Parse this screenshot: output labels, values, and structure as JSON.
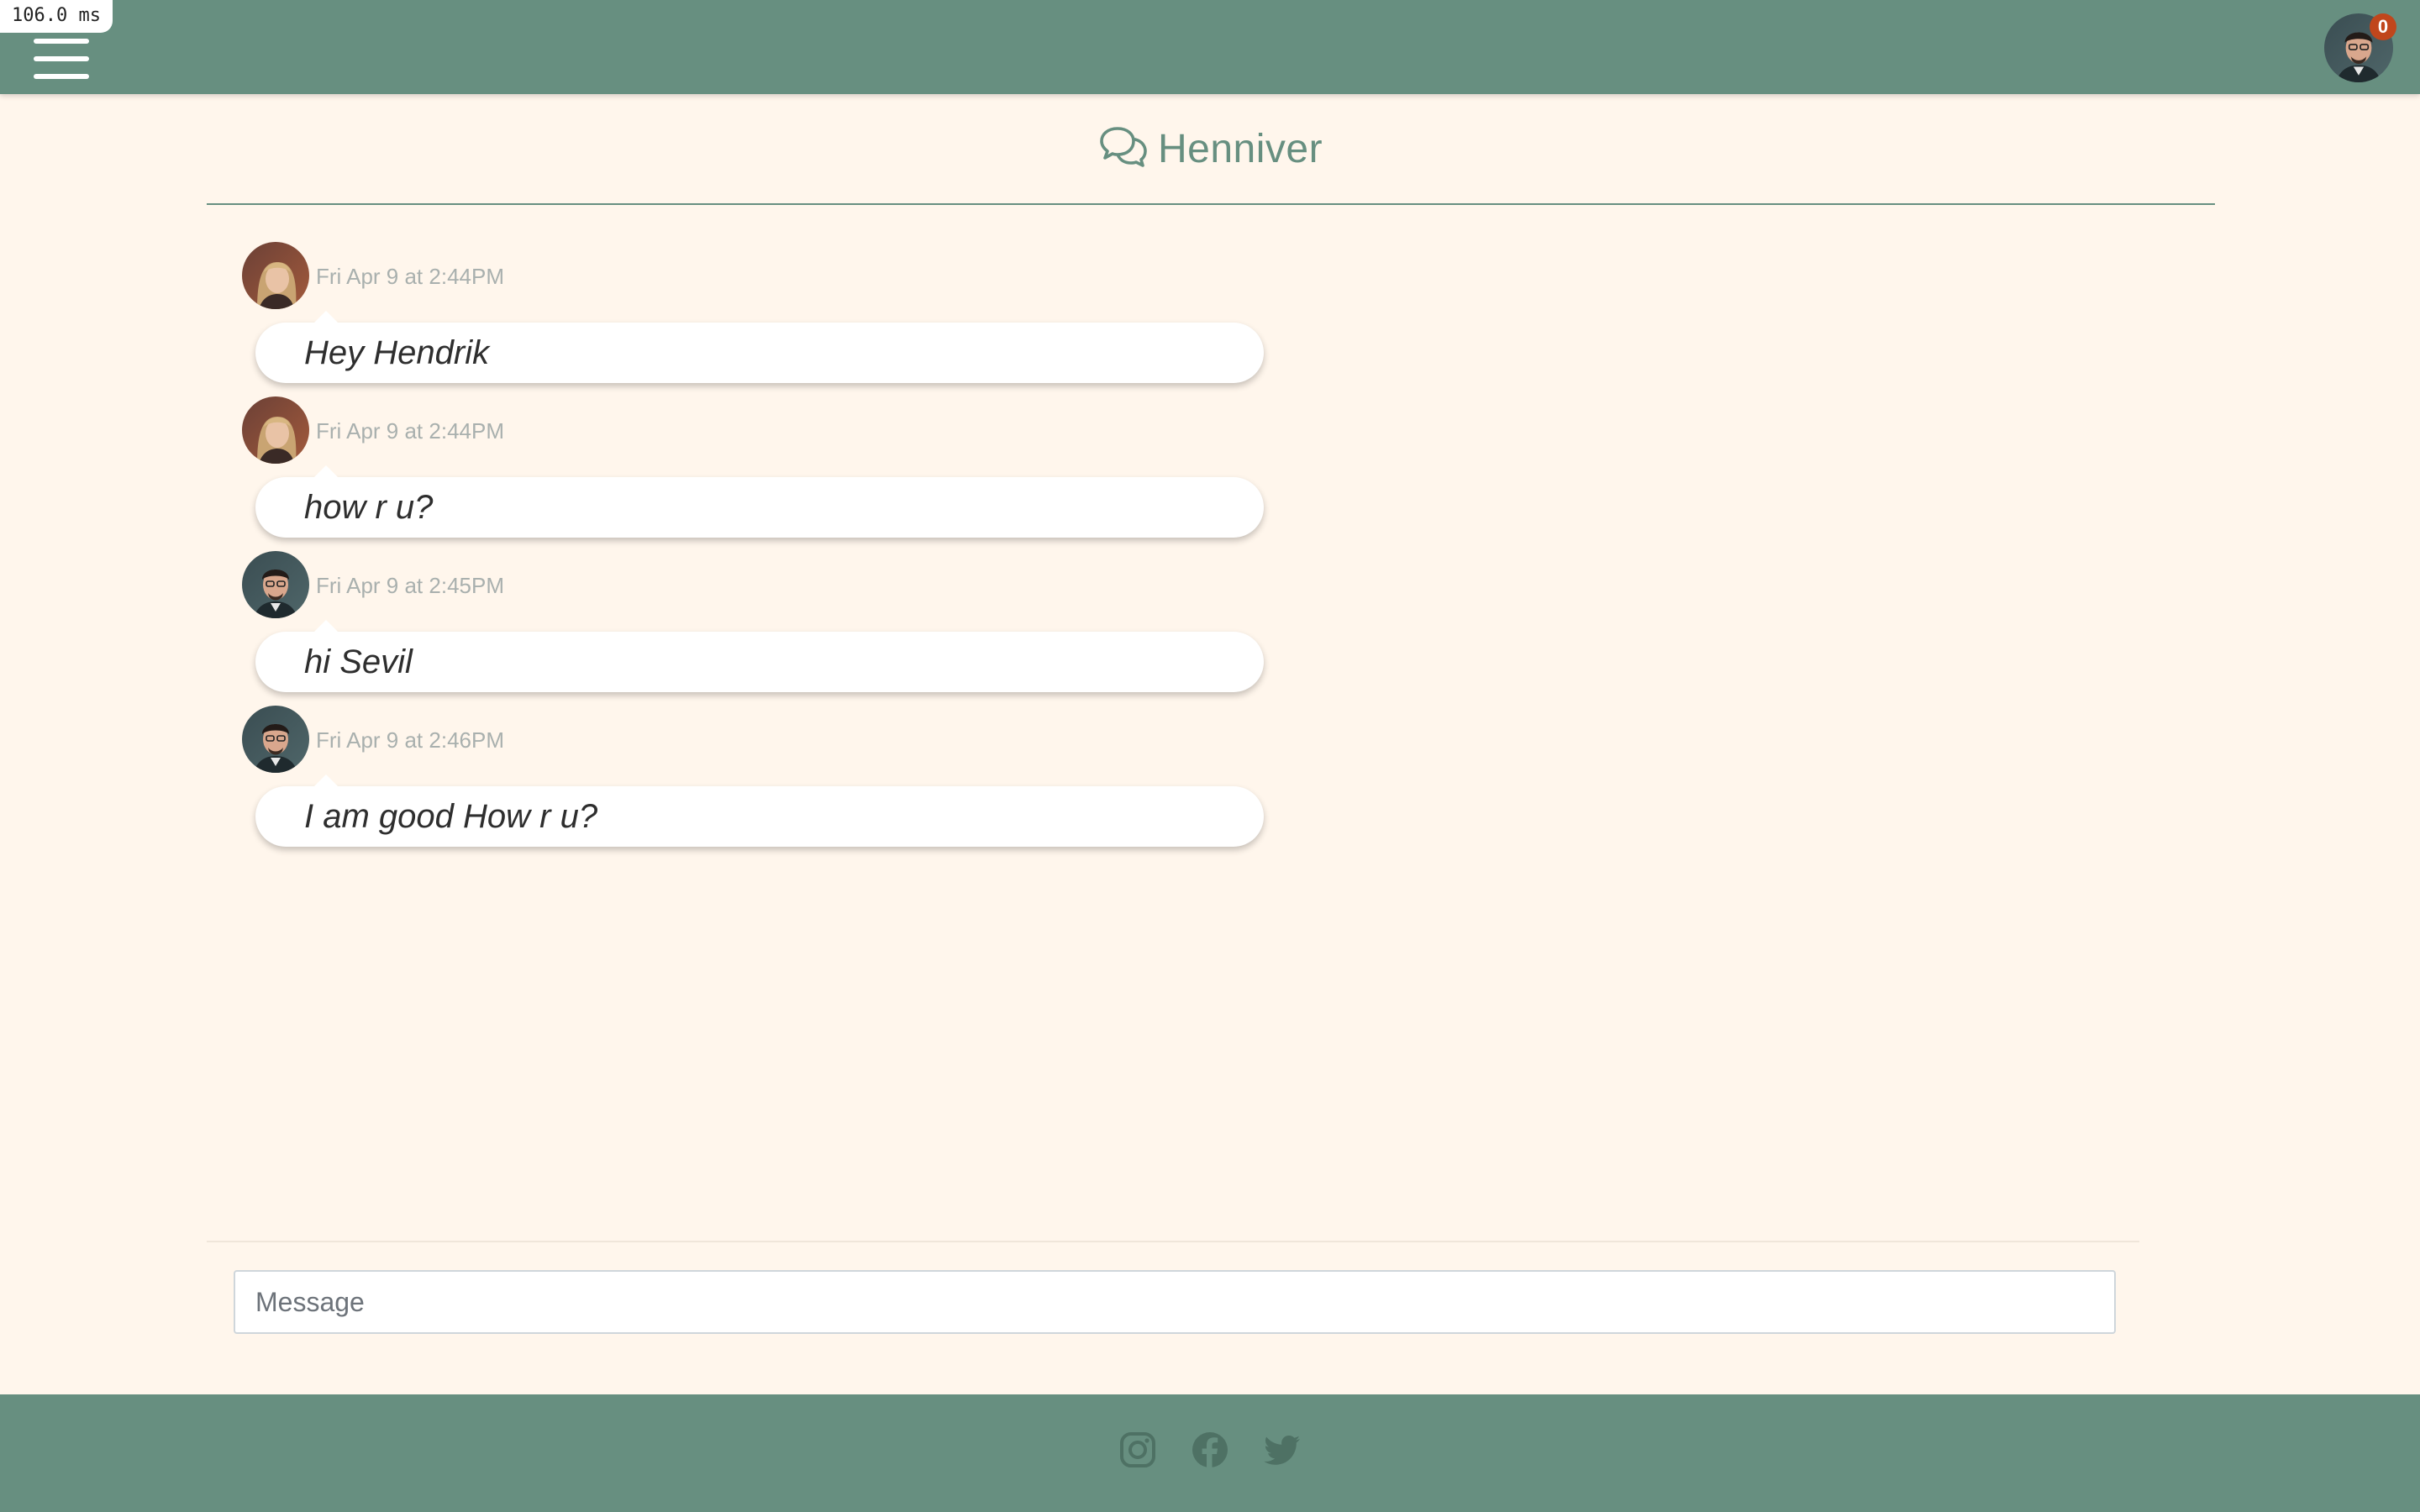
{
  "perf": {
    "label": "106.0 ms"
  },
  "topbar": {
    "menu_icon": "hamburger-menu-icon",
    "profile": {
      "avatar": "user-avatar",
      "notification_count": "0"
    }
  },
  "chat": {
    "icon": "chat-bubbles-icon",
    "title": "Henniver"
  },
  "messages": [
    {
      "sender_avatar": "woman-avatar",
      "time": "Fri Apr 9 at 2:44PM",
      "text": "Hey Hendrik"
    },
    {
      "sender_avatar": "woman-avatar",
      "time": "Fri Apr 9 at 2:44PM",
      "text": "how r u?"
    },
    {
      "sender_avatar": "man-avatar",
      "time": "Fri Apr 9 at 2:45PM",
      "text": "hi Sevil"
    },
    {
      "sender_avatar": "man-avatar",
      "time": "Fri Apr 9 at 2:46PM",
      "text": "I am good How r u?"
    }
  ],
  "composer": {
    "placeholder": "Message",
    "value": ""
  },
  "footer": {
    "icons": [
      "instagram-icon",
      "facebook-icon",
      "twitter-icon"
    ]
  },
  "colors": {
    "brand": "#678f80",
    "background": "#fff6ec",
    "badge": "#c0461c"
  }
}
